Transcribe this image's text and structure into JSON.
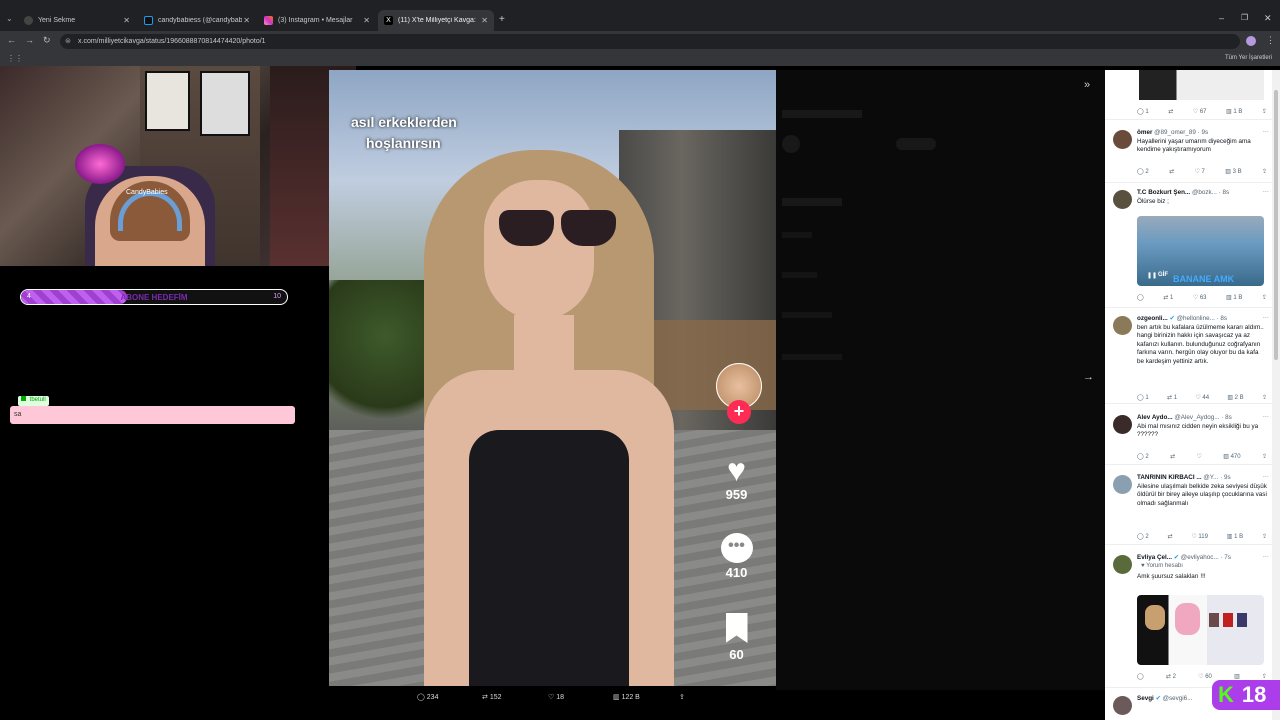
{
  "browser": {
    "tabs": [
      {
        "title": "Yeni Sekme",
        "active": false
      },
      {
        "title": "candybabiess (@candybabiess)",
        "active": false
      },
      {
        "title": "(3) Instagram • Mesajlar",
        "active": false
      },
      {
        "title": "(11) X'te Milliyetçi Kavga: \"#Sa",
        "active": true
      }
    ],
    "url": "x.com/milliyetcikavga/status/1966088870814474420/photo/1",
    "bookmarks_label": "Tüm Yer İşaretleri"
  },
  "stream": {
    "webcam_tag": "CandyBabies",
    "goal": {
      "label": "ABONE HEDEFİM",
      "current": "4",
      "target": "10",
      "progress_fraction": 0.4
    },
    "chat": {
      "user": "tbetull",
      "message": "sa"
    },
    "kick_badge": {
      "letter": "K",
      "age": "18"
    }
  },
  "video": {
    "caption_lines": [
      "asıl erkeklerden",
      "hoşlanırsın"
    ],
    "likes": "959",
    "comments": "410",
    "saves": "60"
  },
  "post_stats": {
    "replies": "234",
    "reposts": "152",
    "likes": "18",
    "views": "122 B"
  },
  "replies": [
    {
      "name": "",
      "handle": "",
      "time": "",
      "text": "",
      "acts": [
        "1",
        "",
        "67",
        "1 B",
        ""
      ]
    },
    {
      "name": "ömer",
      "handle": "@89_omer_89",
      "time": "· 9s",
      "text": "Hayallerini yaşar umarım diyeceğim ama kendime yakıştıramıyorum",
      "acts": [
        "2",
        "",
        "7",
        "3 B",
        ""
      ]
    },
    {
      "name": "T.C Bozkurt Şen...",
      "handle": "@bozk...",
      "time": "· 8s",
      "text": "Ölürse biz ;",
      "gif": "GİF",
      "gif_text": "BANANE AMK",
      "acts": [
        "",
        "1",
        "63",
        "1 B",
        ""
      ]
    },
    {
      "name": "ozgeonli...",
      "handle": "@hellonline...",
      "time": "· 8s",
      "text": "ben artık bu kafalara üzülmeme kararı aldım.. hangi birinizin hakkı için savaşıcaz ya az kafanızı kullanın. bulunduğunuz coğrafyanın farkına varın. hergün olay oluyor bu da kafa be kardeşim yettiniz artık.",
      "acts": [
        "1",
        "1",
        "44",
        "2 B",
        ""
      ]
    },
    {
      "name": "Alev Aydo...",
      "handle": "@Alev_Aydog...",
      "time": "· 8s",
      "text": "Abi mal mısınız cidden neyin eksikliği bu ya ??????",
      "acts": [
        "2",
        "",
        "",
        "470",
        ""
      ]
    },
    {
      "name": "TANRININ KIRBACI ...",
      "handle": "@Y...",
      "time": "· 9s",
      "text": "Ailesine ulaşılmalı belkide zeka seviyesi düşük öldürül bir birey aileye ulaşılıp çocuklarına vasi olmadı sağlanmalı",
      "acts": [
        "2",
        "",
        "119",
        "1 B",
        ""
      ]
    },
    {
      "name": "Evliya Çel...",
      "handle": "@evliyahoc...",
      "time": "· 7s",
      "sub": "Yorum hesabı",
      "text": "Amk şuursuz salakları !!!",
      "acts": [
        "",
        "2",
        "60",
        "",
        ""
      ]
    },
    {
      "name": "Sevgi",
      "handle": "@sevgi6...",
      "time": "",
      "text": "",
      "acts": []
    }
  ],
  "colors": {
    "accent": "#1d9bf0",
    "tiktok_red": "#fe2c55",
    "kick_green": "#53fc18",
    "kick_purple": "#ab3eea"
  }
}
